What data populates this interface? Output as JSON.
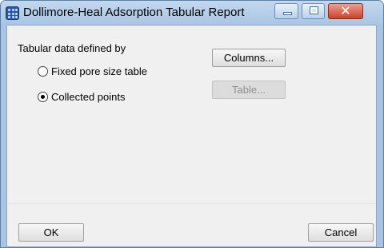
{
  "window": {
    "title": "Dollimore-Heal Adsorption Tabular Report"
  },
  "form": {
    "group_label": "Tabular data defined by",
    "options": [
      {
        "label": "Fixed pore size table",
        "selected": false
      },
      {
        "label": "Collected points",
        "selected": true
      }
    ],
    "columns_button": "Columns...",
    "table_button": "Table..."
  },
  "footer": {
    "ok_label": "OK",
    "cancel_label": "Cancel"
  },
  "icons": {
    "app": "grid-app-icon",
    "minimize": "minimize-icon",
    "maximize": "maximize-icon",
    "close": "close-icon"
  }
}
